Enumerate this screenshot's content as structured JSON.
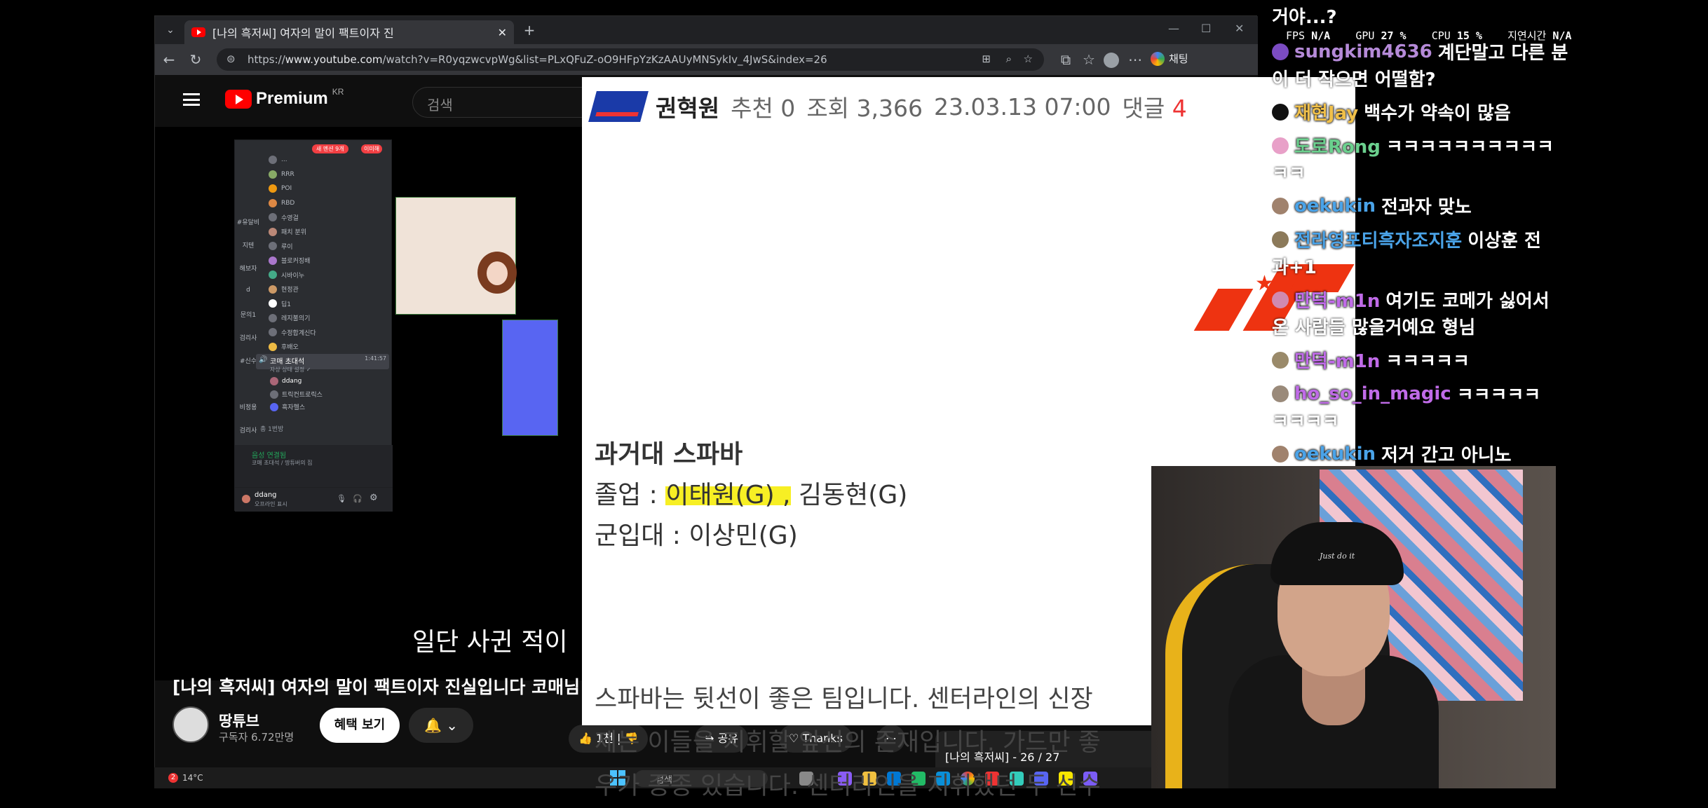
{
  "browser": {
    "tab_title": "[나의 흑저씨] 여자의 말이 팩트이자 진",
    "url_domain": "www.youtube.com",
    "url_prefix": "https://",
    "url_path": "/watch?v=R0yqzwcvpWg&list=PLxQFuZ-oO9HFpYzKzAAUyMNSykIv_4JwS&index=26",
    "new_tab_label": "+",
    "chat_button": "채팅"
  },
  "youtube": {
    "logo_text": "Premium",
    "logo_region": "KR",
    "search_placeholder": "검색",
    "subtitle": "일단 사귄 적이",
    "video_title": "[나의 흑저씨] 여자의 말이 팩트이자 진실입니다 코매님",
    "channel_name": "땅튜브",
    "subscribers": "구독자 6.72만명",
    "perks_button": "혜택 보기",
    "like_label": "1천",
    "share_label": "공유",
    "thanks_label": "Thanks",
    "playlist_label": "[나의 흑저씨] - 26 / 27"
  },
  "discord": {
    "badge": "새 멘션 9개",
    "badge2": "이미해",
    "rows": [
      "...",
      "RRR",
      "POI",
      "RBD",
      "수영걸",
      "패치 분위",
      "루이",
      "블로커징배",
      "시바이누",
      "현정관",
      "딥1",
      "레지불의기",
      "수정합계신다",
      "후배오"
    ],
    "left_labels": [
      "#유달비",
      "지텐",
      "해보자",
      "d",
      "문의1",
      "검리사",
      "#신수",
      "",
      "비정용",
      "검리사"
    ],
    "voice_channel": "코매 초대석",
    "voice_time": "1:41:57",
    "voice_sub": "자상 상태 설정 ✓",
    "voice_members": [
      "ddang",
      "트릭컨트로릭스",
      "흑자헬스"
    ],
    "voice_footer": "총 1번방",
    "connected_label": "음성 연결됨",
    "connected_sub": "코매 초대석 / 땅튜버의 집",
    "username": "ddang",
    "user_status": "오프라인 표시"
  },
  "post": {
    "author": "권혁원",
    "recommend": "추천 0",
    "views": "조회 3,366",
    "date": "23.03.13 07:00",
    "comments_label": "댓글",
    "comments_count": "4",
    "section_title": "과거대 스파바",
    "graduation_label": "졸업 : ",
    "graduation_hl": "이태원(G) ,",
    "graduation_rest": " 김동현(G)",
    "military_label": "군입대 : ",
    "military_names": " 이상민(G)",
    "para_lines": [
      "스파바는 뒷선이 좋은 팀입니다. 센터라인의 신장",
      "제는 이들을 지휘할 앞선의 존재입니다. 가드만 좋",
      "우가 종종 있습니다. 센터라인을 지휘했던 두 선수"
    ]
  },
  "stats": {
    "fps_label": "FPS",
    "fps": "N/A",
    "gpu_label": "GPU",
    "gpu": "27 %",
    "cpu_label": "CPU",
    "cpu": "15 %",
    "latency_label": "지연시간",
    "latency": "N/A"
  },
  "chat": {
    "top_fragment": "거야...?",
    "messages": [
      {
        "nick": "sungkim4636",
        "nick_color": "#b58ad8",
        "avatar_color": "#7b4cc2",
        "text": "계단말고 다른 분",
        "cont": "이 더 작으면 어떨함?"
      },
      {
        "nick": "재현Jay",
        "nick_color": "#f0c04a",
        "avatar_color": "#111111",
        "text": "백수가 약속이 많음",
        "cont": ""
      },
      {
        "nick": "도로Rong",
        "nick_color": "#6bd08e",
        "avatar_color": "#e8a0c8",
        "text": "ㅋㅋㅋㅋㅋㅋㅋㅋㅋㅋ",
        "cont": "ㅋㅋ"
      },
      {
        "nick": "oekukin",
        "nick_color": "#4aa3e8",
        "avatar_color": "#a0826d",
        "text": "전과자 맞노",
        "cont": ""
      },
      {
        "nick": "전라영포티흑자조지훈",
        "nick_color": "#4aa3e8",
        "avatar_color": "#8c7a5a",
        "text": "이상훈 전",
        "cont": "과+1"
      },
      {
        "nick": "만덕-m1n",
        "nick_color": "#c06be8",
        "avatar_color": "#d08ab0",
        "text": "여기도 코메가 싫어서",
        "cont": "온 사람들 많을거예요 형님"
      },
      {
        "nick": "만덕-m1n",
        "nick_color": "#c06be8",
        "avatar_color": "#9a8a6a",
        "text": "ㅋㅋㅋㅋㅋ",
        "cont": ""
      },
      {
        "nick": "ho_so_in_magic",
        "nick_color": "#c06be8",
        "avatar_color": "#9a8a7a",
        "text": "ㅋㅋㅋㅋㅋ",
        "cont": "ㅋㅋㅋㅋ"
      },
      {
        "nick": "oekukin",
        "nick_color": "#4aa3e8",
        "avatar_color": "#a0826d",
        "text": "저거 간고 아니노",
        "cont": ""
      }
    ]
  },
  "webcam": {
    "cap_text": "Just do it"
  },
  "taskbar": {
    "weather": "14°C",
    "search": "검색",
    "notif_count": "2"
  }
}
